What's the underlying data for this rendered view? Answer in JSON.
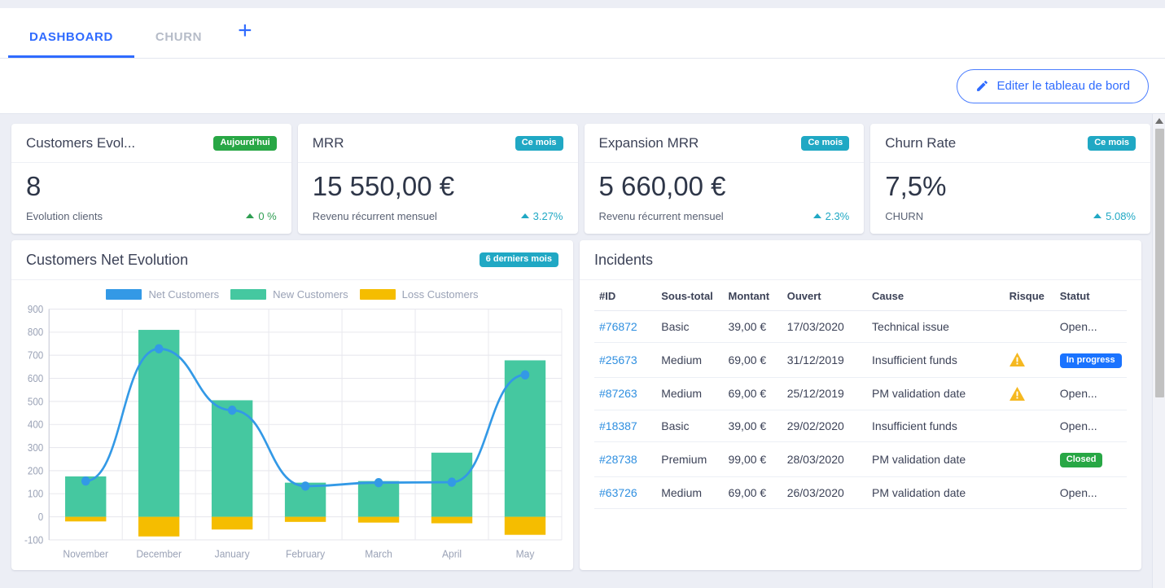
{
  "tabs": [
    {
      "label": "DASHBOARD",
      "active": true
    },
    {
      "label": "CHURN",
      "active": false
    }
  ],
  "add_tab_label": "+",
  "toolbar": {
    "edit_label": "Editer le tableau de bord",
    "edit_icon": "pencil-icon"
  },
  "kpis": [
    {
      "title": "Customers Evol...",
      "badge": "Aujourd'hui",
      "badge_color": "#28a745",
      "value": "8",
      "subtitle": "Evolution clients",
      "delta": "0 %",
      "delta_color": "#2f9e52",
      "trend": "up"
    },
    {
      "title": "MRR",
      "badge": "Ce mois",
      "badge_color": "#20a8c4",
      "value": "15 550,00 €",
      "subtitle": "Revenu récurrent mensuel",
      "delta": "3.27%",
      "delta_color": "#20a8c4",
      "trend": "up"
    },
    {
      "title": "Expansion MRR",
      "badge": "Ce mois",
      "badge_color": "#20a8c4",
      "value": "5 660,00 €",
      "subtitle": "Revenu récurrent mensuel",
      "delta": "2.3%",
      "delta_color": "#20a8c4",
      "trend": "up"
    },
    {
      "title": "Churn Rate",
      "badge": "Ce mois",
      "badge_color": "#20a8c4",
      "value": "7,5%",
      "subtitle": "CHURN",
      "delta": "5.08%",
      "delta_color": "#20a8c4",
      "trend": "up"
    }
  ],
  "chart_card": {
    "title": "Customers Net Evolution",
    "badge": "6 derniers mois",
    "badge_color": "#20a8c4"
  },
  "chart_data": {
    "type": "bar",
    "title": "Customers Net Evolution",
    "xlabel": "",
    "ylabel": "",
    "ylim": [
      -100,
      900
    ],
    "yticks": [
      900,
      800,
      700,
      600,
      500,
      400,
      300,
      200,
      100,
      0,
      -100
    ],
    "grid": true,
    "legend_position": "top-center",
    "categories": [
      "November",
      "December",
      "January",
      "February",
      "March",
      "April",
      "May"
    ],
    "series": [
      {
        "name": "New Customers",
        "type": "bar",
        "color": "#45c8a0",
        "values": [
          175,
          810,
          505,
          148,
          155,
          278,
          678
        ]
      },
      {
        "name": "Loss Customers",
        "type": "bar",
        "color": "#f5bd00",
        "values": [
          -20,
          -85,
          -55,
          -22,
          -25,
          -28,
          -78
        ]
      },
      {
        "name": "Net Customers",
        "type": "line",
        "color": "#3399e6",
        "values": [
          155,
          728,
          462,
          133,
          148,
          150,
          615
        ]
      }
    ]
  },
  "table_card": {
    "title": "Incidents",
    "columns": [
      "#ID",
      "Sous-total",
      "Montant",
      "Ouvert",
      "Cause",
      "Risque",
      "Statut"
    ],
    "rows": [
      {
        "id": "#76872",
        "subtotal": "Basic",
        "amount": "39,00 €",
        "opened": "17/03/2020",
        "cause": "Technical issue",
        "risk": "",
        "status": "Open...",
        "status_type": "plain"
      },
      {
        "id": "#25673",
        "subtotal": "Medium",
        "amount": "69,00 €",
        "opened": "31/12/2019",
        "cause": "Insufficient funds",
        "risk": "warning-icon",
        "status": "In progress",
        "status_type": "blue"
      },
      {
        "id": "#87263",
        "subtotal": "Medium",
        "amount": "69,00 €",
        "opened": "25/12/2019",
        "cause": "PM validation date",
        "risk": "warning-icon",
        "status": "Open...",
        "status_type": "plain"
      },
      {
        "id": "#18387",
        "subtotal": "Basic",
        "amount": "39,00 €",
        "opened": "29/02/2020",
        "cause": "Insufficient funds",
        "risk": "",
        "status": "Open...",
        "status_type": "plain"
      },
      {
        "id": "#28738",
        "subtotal": "Premium",
        "amount": "99,00 €",
        "opened": "28/03/2020",
        "cause": "PM validation date",
        "risk": "",
        "status": "Closed",
        "status_type": "green"
      },
      {
        "id": "#63726",
        "subtotal": "Medium",
        "amount": "69,00 €",
        "opened": "26/03/2020",
        "cause": "PM validation date",
        "risk": "",
        "status": "Open...",
        "status_type": "plain"
      }
    ]
  },
  "colors": {
    "accent_blue": "#2f6bff",
    "net_customers": "#3399e6",
    "new_customers": "#45c8a0",
    "loss_customers": "#f5bd00",
    "badge_green": "#28a745",
    "badge_teal": "#20a8c4",
    "badge_blue": "#1a73ff",
    "page_background": "#eceef5"
  }
}
